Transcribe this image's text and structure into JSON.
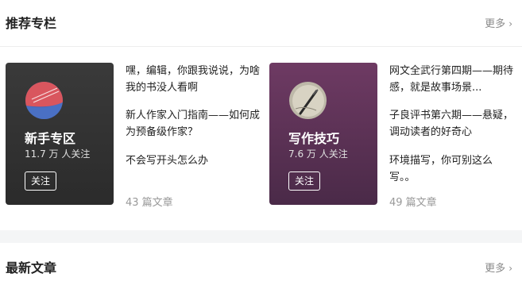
{
  "recommended": {
    "title": "推荐专栏",
    "more_label": "更多"
  },
  "columns": [
    {
      "name": "新手专区",
      "followers": "11.7 万 人关注",
      "follow_label": "关注",
      "articles": [
        "嘿，编辑，你跟我说说，为啥我的书没人看啊",
        "新人作家入门指南——如何成为预备级作家？",
        "不会写开头怎么办"
      ],
      "count": "43 篇文章"
    },
    {
      "name": "写作技巧",
      "followers": "7.6 万 人关注",
      "follow_label": "关注",
      "articles": [
        "网文全武行第四期——期待感，就是故事场景...",
        "子良评书第六期——悬疑，调动读者的好奇心",
        "环境描写，你可别这么写。。"
      ],
      "count": "49 篇文章"
    }
  ],
  "latest": {
    "title": "最新文章",
    "more_label": "更多"
  }
}
